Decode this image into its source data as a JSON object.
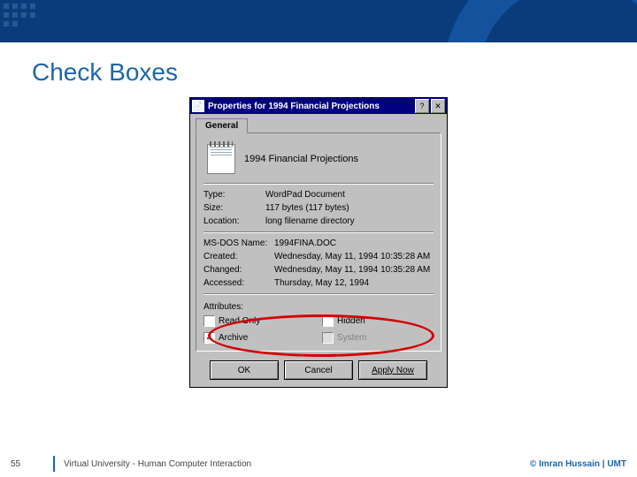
{
  "slide": {
    "title": "Check Boxes",
    "page_number": "55",
    "footer_text": "Virtual University - Human Computer Interaction",
    "copyright": "© Imran Hussain | UMT"
  },
  "dialog": {
    "title": "Properties for 1994 Financial Projections",
    "help_btn": "?",
    "close_btn": "✕",
    "tab_label": "General",
    "filename": "1994 Financial Projections",
    "info": {
      "type_label": "Type:",
      "type_value": "WordPad Document",
      "size_label": "Size:",
      "size_value": "117 bytes (117 bytes)",
      "location_label": "Location:",
      "location_value": "long filename directory",
      "msdos_label": "MS-DOS Name:",
      "msdos_value": "1994FINA.DOC",
      "created_label": "Created:",
      "created_value": "Wednesday, May 11, 1994 10:35:28 AM",
      "changed_label": "Changed:",
      "changed_value": "Wednesday, May 11, 1994 10:35:28 AM",
      "accessed_label": "Accessed:",
      "accessed_value": "Thursday, May 12, 1994"
    },
    "attributes": {
      "label": "Attributes:",
      "read_only": "Read Only",
      "hidden": "Hidden",
      "archive": "Archive",
      "system": "System",
      "archive_checked": "✓"
    },
    "buttons": {
      "ok": "OK",
      "cancel": "Cancel",
      "apply": "Apply Now"
    }
  }
}
